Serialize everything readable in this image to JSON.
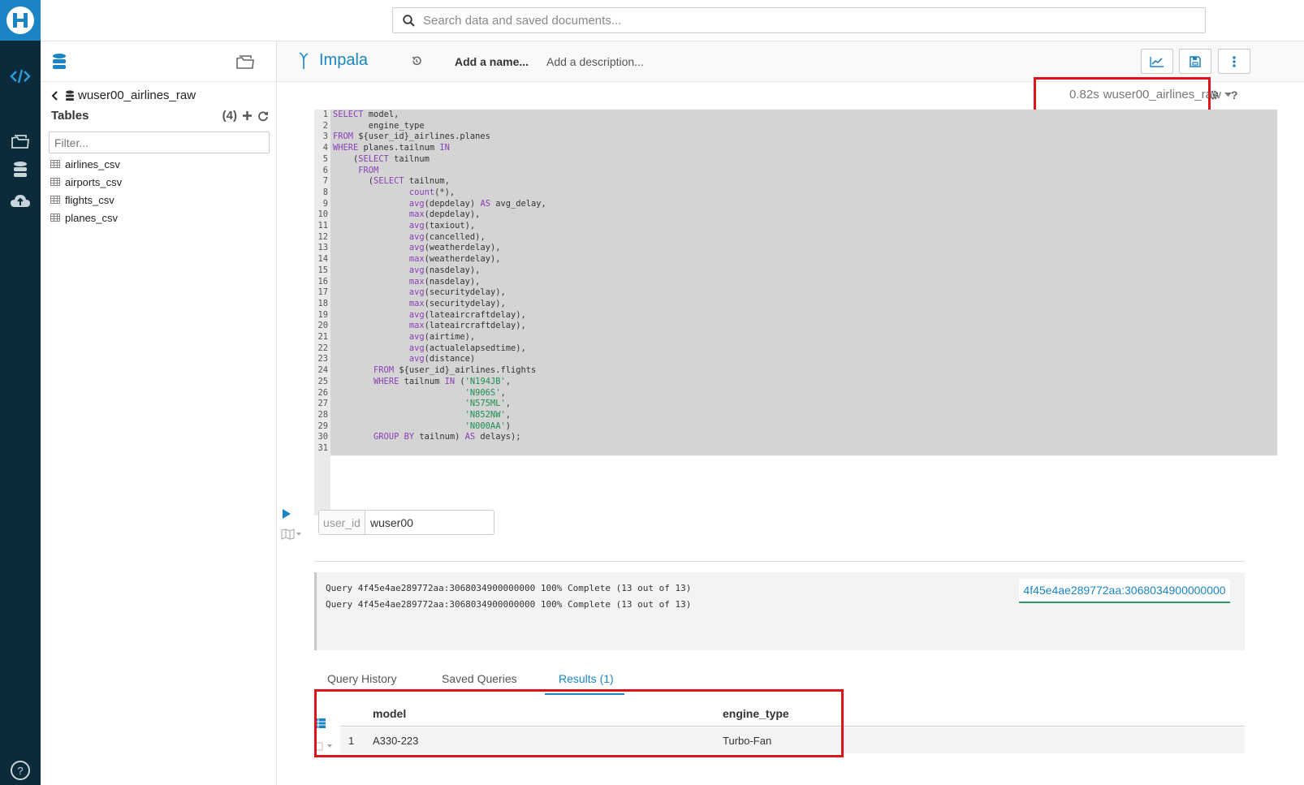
{
  "app": {
    "logo_letter": "H",
    "search_placeholder": "Search data and saved documents..."
  },
  "rail": {
    "icons": [
      "hue-logo",
      "editor-icon",
      "files-icon",
      "database-icon",
      "upload-cloud-icon",
      "help-icon"
    ]
  },
  "assist": {
    "database": "wuser00_airlines_raw",
    "tables_label": "Tables",
    "tables_count": "(4)",
    "filter_placeholder": "Filter...",
    "tables": [
      "airlines_csv",
      "airports_csv",
      "flights_csv",
      "planes_csv"
    ]
  },
  "editor": {
    "engine": "Impala",
    "name_placeholder": "Add a name...",
    "description_placeholder": "Add a description...",
    "exec_time": "0.82s",
    "active_database": "wuser00_airlines_raw",
    "help": "?",
    "code_lines": [
      [
        [
          "kw",
          "SELECT"
        ],
        [
          "txt",
          " model,"
        ]
      ],
      [
        [
          "txt",
          "       engine_type"
        ]
      ],
      [
        [
          "kw",
          "FROM"
        ],
        [
          "txt",
          " ${user_id}_airlines.planes"
        ]
      ],
      [
        [
          "kw",
          "WHERE"
        ],
        [
          "txt",
          " planes.tailnum "
        ],
        [
          "kw",
          "IN"
        ]
      ],
      [
        [
          "txt",
          "    ("
        ],
        [
          "kw",
          "SELECT"
        ],
        [
          "txt",
          " tailnum"
        ]
      ],
      [
        [
          "txt",
          "     "
        ],
        [
          "kw",
          "FROM"
        ]
      ],
      [
        [
          "txt",
          "       ("
        ],
        [
          "kw",
          "SELECT"
        ],
        [
          "txt",
          " tailnum,"
        ]
      ],
      [
        [
          "txt",
          "               "
        ],
        [
          "kw",
          "count"
        ],
        [
          "txt",
          "(*),"
        ]
      ],
      [
        [
          "txt",
          "               "
        ],
        [
          "kw",
          "avg"
        ],
        [
          "txt",
          "(depdelay) "
        ],
        [
          "kw",
          "AS"
        ],
        [
          "txt",
          " avg_delay,"
        ]
      ],
      [
        [
          "txt",
          "               "
        ],
        [
          "kw",
          "max"
        ],
        [
          "txt",
          "(depdelay),"
        ]
      ],
      [
        [
          "txt",
          "               "
        ],
        [
          "kw",
          "avg"
        ],
        [
          "txt",
          "(taxiout),"
        ]
      ],
      [
        [
          "txt",
          "               "
        ],
        [
          "kw",
          "avg"
        ],
        [
          "txt",
          "(cancelled),"
        ]
      ],
      [
        [
          "txt",
          "               "
        ],
        [
          "kw",
          "avg"
        ],
        [
          "txt",
          "(weatherdelay),"
        ]
      ],
      [
        [
          "txt",
          "               "
        ],
        [
          "kw",
          "max"
        ],
        [
          "txt",
          "(weatherdelay),"
        ]
      ],
      [
        [
          "txt",
          "               "
        ],
        [
          "kw",
          "avg"
        ],
        [
          "txt",
          "(nasdelay),"
        ]
      ],
      [
        [
          "txt",
          "               "
        ],
        [
          "kw",
          "max"
        ],
        [
          "txt",
          "(nasdelay),"
        ]
      ],
      [
        [
          "txt",
          "               "
        ],
        [
          "kw",
          "avg"
        ],
        [
          "txt",
          "(securitydelay),"
        ]
      ],
      [
        [
          "txt",
          "               "
        ],
        [
          "kw",
          "max"
        ],
        [
          "txt",
          "(securitydelay),"
        ]
      ],
      [
        [
          "txt",
          "               "
        ],
        [
          "kw",
          "avg"
        ],
        [
          "txt",
          "(lateaircraftdelay),"
        ]
      ],
      [
        [
          "txt",
          "               "
        ],
        [
          "kw",
          "max"
        ],
        [
          "txt",
          "(lateaircraftdelay),"
        ]
      ],
      [
        [
          "txt",
          "               "
        ],
        [
          "kw",
          "avg"
        ],
        [
          "txt",
          "(airtime),"
        ]
      ],
      [
        [
          "txt",
          "               "
        ],
        [
          "kw",
          "avg"
        ],
        [
          "txt",
          "(actualelapsedtime),"
        ]
      ],
      [
        [
          "txt",
          "               "
        ],
        [
          "kw",
          "avg"
        ],
        [
          "txt",
          "(distance)"
        ]
      ],
      [
        [
          "txt",
          "        "
        ],
        [
          "kw",
          "FROM"
        ],
        [
          "txt",
          " ${user_id}_airlines.flights"
        ]
      ],
      [
        [
          "txt",
          "        "
        ],
        [
          "kw",
          "WHERE"
        ],
        [
          "txt",
          " tailnum "
        ],
        [
          "kw",
          "IN"
        ],
        [
          "txt",
          " ("
        ],
        [
          "str",
          "'N194JB'"
        ],
        [
          "txt",
          ","
        ]
      ],
      [
        [
          "txt",
          "                          "
        ],
        [
          "str",
          "'N906S'"
        ],
        [
          "txt",
          ","
        ]
      ],
      [
        [
          "txt",
          "                          "
        ],
        [
          "str",
          "'N575ML'"
        ],
        [
          "txt",
          ","
        ]
      ],
      [
        [
          "txt",
          "                          "
        ],
        [
          "str",
          "'N852NW'"
        ],
        [
          "txt",
          ","
        ]
      ],
      [
        [
          "txt",
          "                          "
        ],
        [
          "str",
          "'N000AA'"
        ],
        [
          "txt",
          ")"
        ]
      ],
      [
        [
          "txt",
          "        "
        ],
        [
          "kw",
          "GROUP BY"
        ],
        [
          "txt",
          " tailnum) "
        ],
        [
          "kw",
          "AS"
        ],
        [
          "txt",
          " delays);"
        ]
      ],
      []
    ]
  },
  "params": {
    "label": "user_id",
    "value": "wuser00"
  },
  "log": {
    "lines": [
      "Query 4f45e4ae289772aa:3068034900000000 100% Complete (13 out of 13)",
      "Query 4f45e4ae289772aa:3068034900000000 100% Complete (13 out of 13)"
    ],
    "query_id": "4f45e4ae289772aa:3068034900000000"
  },
  "tabs": [
    "Query History",
    "Saved Queries",
    "Results (1)"
  ],
  "results": {
    "columns": [
      "model",
      "engine_type"
    ],
    "rows": [
      [
        "1",
        "A330-223",
        "Turbo-Fan"
      ]
    ]
  },
  "colors": {
    "rail_bg": "#0b2a3a",
    "accent": "#1a84c4",
    "highlight_box": "#e0121a"
  }
}
